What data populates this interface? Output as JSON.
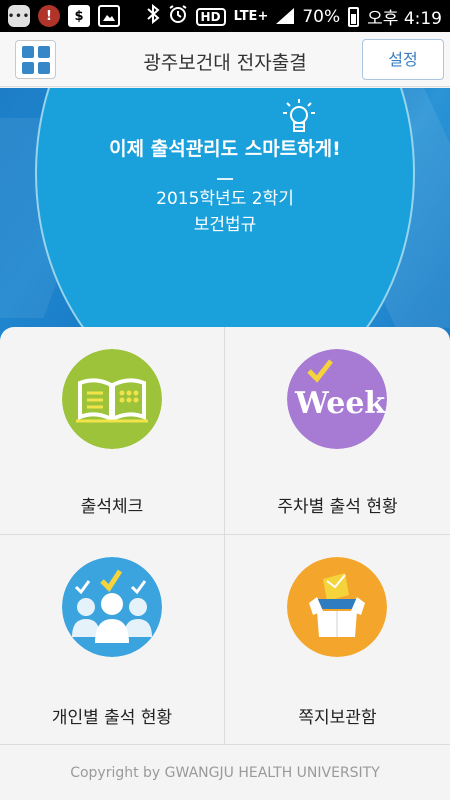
{
  "status_bar": {
    "battery": "70%",
    "time": "오후 4:19",
    "hd_label": "HD",
    "network": "LTE+",
    "icons": [
      "chat-icon",
      "record-icon",
      "money-icon",
      "gallery-icon",
      "bluetooth-icon",
      "alarm-icon",
      "signal-icon",
      "battery-icon"
    ]
  },
  "header": {
    "title": "광주보건대 전자출결",
    "settings_label": "설정",
    "menu_icon": "grid-menu-icon"
  },
  "banner": {
    "headline": "이제 출석관리도 스마트하게!",
    "semester": "2015학년도 2학기",
    "course": "보건법규",
    "icon": "lightbulb-icon"
  },
  "menu": {
    "items": [
      {
        "label": "출석체크",
        "icon": "book-icon",
        "color": "#9cc33a"
      },
      {
        "label": "주차별 출석 현황",
        "icon": "week-icon",
        "color": "#a77bd4"
      },
      {
        "label": "개인별 출석 현황",
        "icon": "people-icon",
        "color": "#3ba3dd"
      },
      {
        "label": "쪽지보관함",
        "icon": "box-icon",
        "color": "#f3a62b"
      }
    ]
  },
  "footer": {
    "copyright": "Copyright by GWANGJU HEALTH UNIVERSITY"
  },
  "colors": {
    "accent": "#3587c7",
    "banner_blue": "#1aa0da",
    "header_bg": "#f7f7f7"
  }
}
